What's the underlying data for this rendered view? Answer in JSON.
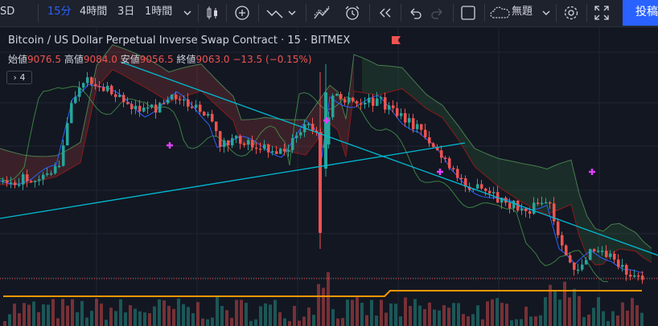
{
  "toolbar": {
    "symbol_fragment": "SD",
    "intervals": [
      "15分",
      "4時間",
      "3日",
      "1時間"
    ],
    "template": "無題",
    "publish": "投稿"
  },
  "legend": {
    "title": "Bitcoin / US Dollar Perpetual Inverse Swap Contract · 15 · BITMEX",
    "open_label": "始値",
    "open": "9076.5",
    "high_label": "高値",
    "high": "9084.0",
    "low_label": "安値",
    "low": "9056.5",
    "close_label": "終値",
    "close": "9063.0",
    "change": "−13.5 (−0.15%)",
    "collapse_count": "4"
  },
  "colors": {
    "up": "#26a69a",
    "down": "#ef5350",
    "background": "#131722",
    "trendline": "#00bcd4",
    "volume_ma": "#ff9800",
    "ichimoku_cloud_bear": "#ef5350",
    "ichimoku_cloud_bull": "#4caf50",
    "marker": "#e040fb",
    "accent": "#2962ff"
  },
  "icons": [
    "chevron-down-icon",
    "candles-icon",
    "add-indicator-icon",
    "line-tools-icon",
    "compare-icon",
    "alert-clock-icon",
    "replay-icon",
    "undo-icon",
    "redo-icon",
    "layout-icon",
    "cloud-icon",
    "gear-icon",
    "fullscreen-icon",
    "flag-icon"
  ]
}
